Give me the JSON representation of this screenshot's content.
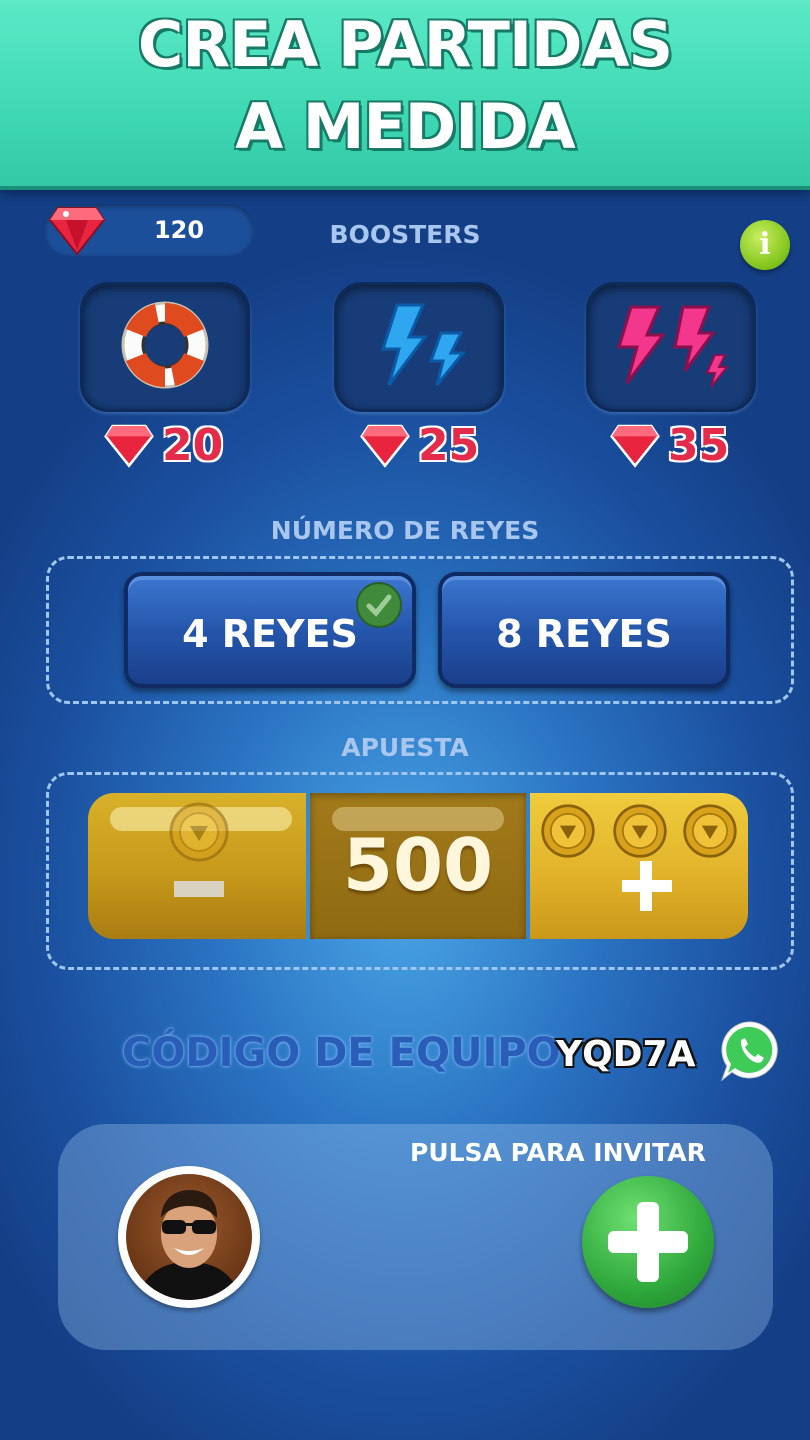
{
  "banner": {
    "line1": "CREA PARTIDAS",
    "line2": "A MEDIDA"
  },
  "gems": {
    "count": "120",
    "icon": "gem-icon"
  },
  "boosters": {
    "title": "BOOSTERS",
    "info_icon": "info-icon",
    "info_label": "i",
    "items": [
      {
        "icon": "lifebuoy-icon",
        "price": "20"
      },
      {
        "icon": "blue-lightning-icon",
        "price": "25"
      },
      {
        "icon": "pink-lightning-icon",
        "price": "35"
      }
    ]
  },
  "kings": {
    "title": "NÚMERO DE REYES",
    "options": [
      {
        "label": "4 REYES",
        "selected": true
      },
      {
        "label": "8 REYES",
        "selected": false
      }
    ]
  },
  "bet": {
    "title": "APUESTA",
    "value": "500",
    "decrease_icon": "minus-icon",
    "increase_icon": "plus-icon"
  },
  "team": {
    "label": "CÓDIGO DE EQUIPO:",
    "code": "YQD7A",
    "share_icon": "whatsapp-icon"
  },
  "invite": {
    "label": "PULSA PARA INVITAR",
    "add_icon": "plus-icon"
  },
  "colors": {
    "banner": "#3fd9b4",
    "price": "#e52b4a",
    "gold": "#e2b32a",
    "green": "#2fa83c",
    "background": "#2a73c2"
  }
}
